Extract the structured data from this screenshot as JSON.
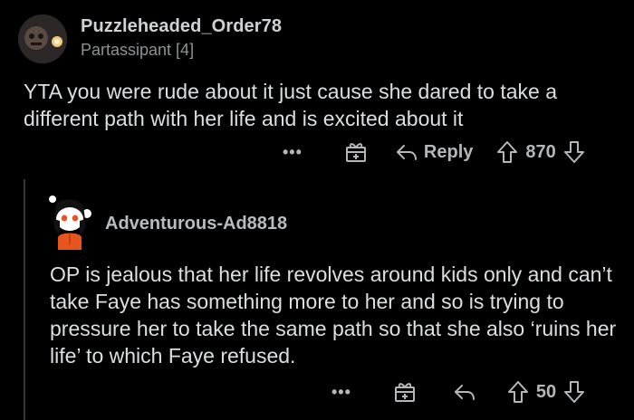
{
  "top_comment": {
    "username": "Puzzleheaded_Order78",
    "flair": "Partassipant [4]",
    "body": "YTA you were rude about it just cause she dared to take a different path with her life and is excited about it",
    "actions": {
      "more_label": "•••",
      "reply_label": "Reply",
      "score": "870"
    }
  },
  "reply_comment": {
    "username": "Adventurous-Ad8818",
    "body": "OP is jealous that her life revolves around kids only and can’t take Faye has something more to her and so is trying to pressure her to take the same path so that she also ‘ruins her life’ to which Faye refused.",
    "actions": {
      "more_label": "•••",
      "score": "50"
    }
  },
  "colors": {
    "background": "#000000",
    "text": "#dcdfe1",
    "muted": "#8e9193",
    "thread_line": "#343536",
    "avatar_accent": "#e8541d"
  },
  "icons": [
    "more-icon",
    "award-icon",
    "reply-icon",
    "upvote-icon",
    "downvote-icon"
  ]
}
